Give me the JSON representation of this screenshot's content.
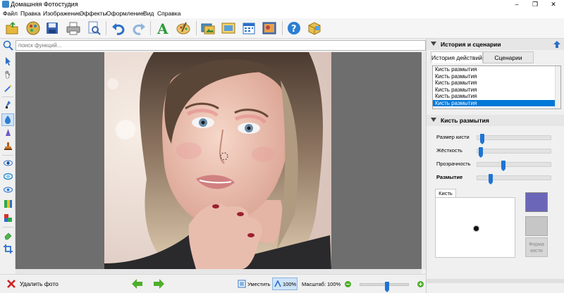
{
  "window": {
    "title": "Домашняя Фотостудия",
    "controls": [
      "minimize",
      "maximize",
      "close"
    ]
  },
  "menu": [
    "Файл",
    "Правка",
    "Изображение",
    "Эффекты",
    "Оформление",
    "Вид",
    "Справка"
  ],
  "toolbar": {
    "buttons": [
      "open-file-icon",
      "palette-disc-icon",
      "save-icon",
      "print-icon",
      "preview-icon",
      "undo-icon",
      "redo-icon",
      "text-icon",
      "painter-palette-icon",
      "slideshow-icon",
      "postcard-icon",
      "calendar-icon",
      "collage-icon",
      "help-icon",
      "box-icon"
    ]
  },
  "search": {
    "placeholder": "поиск функций..."
  },
  "left_tools": [
    "pointer-icon",
    "hand-icon",
    "magic-wand-icon",
    "dropper-icon",
    "blur-drop-icon",
    "sharpen-drop-icon",
    "stamp-icon",
    "red-eye-icon",
    "smooth-icon",
    "eye-outline-icon",
    "levels-icon",
    "color-fill-icon",
    "eraser-icon",
    "crop-icon"
  ],
  "right_panel": {
    "history_title": "История и сценарии",
    "tabs": [
      "История действий",
      "Сценарии"
    ],
    "active_tab": 0,
    "history_items": [
      "Кисть размытия",
      "Кисть размытия",
      "Кисть размытия",
      "Кисть размытия",
      "Кисть размытия",
      "Кисть размытия"
    ],
    "selected_history": 5,
    "brush_title": "Кисть размытия",
    "sliders": [
      {
        "label": "Размер кисти",
        "value": 0.04,
        "bold": false
      },
      {
        "label": "Жёсткость",
        "value": 0.02,
        "bold": false
      },
      {
        "label": "Прозрачность",
        "value": 0.33,
        "bold": false
      },
      {
        "label": "Размытие",
        "value": 0.15,
        "bold": true
      }
    ],
    "brush_tab": "Кисть",
    "color_primary": "#6c66b8",
    "color_secondary": "#c6c6c6",
    "shape_button": "Форма кисти"
  },
  "bottom": {
    "delete_label": "Удалить фото",
    "fit_label": "Уместить",
    "actual_label": "100%",
    "zoom_label": "Масштаб:",
    "zoom_value": "100%",
    "zoom_slider": 0.52
  },
  "colors": {
    "accent": "#1e74d4",
    "selection": "#0078d7",
    "canvas": "#6e6e6e"
  }
}
